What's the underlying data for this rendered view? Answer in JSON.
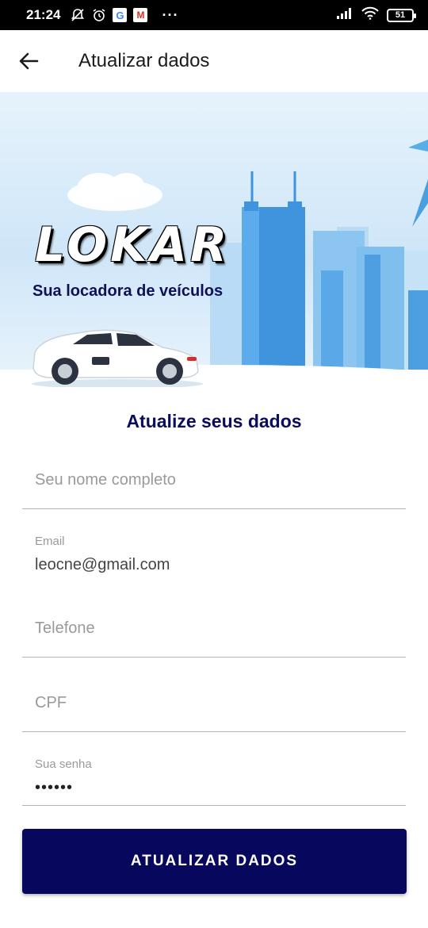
{
  "status_bar": {
    "time": "21:24",
    "google_letter": "G",
    "gmail_letter": "M",
    "more": "···",
    "battery": "51"
  },
  "appbar": {
    "title": "Atualizar dados"
  },
  "banner": {
    "logo_text": "LOKAR",
    "tagline": "Sua locadora de veículos"
  },
  "form": {
    "title": "Atualize seus dados",
    "name_placeholder": "Seu nome completo",
    "name_value": "",
    "email_label": "Email",
    "email_value": "leocne@gmail.com",
    "phone_placeholder": "Telefone",
    "phone_value": "",
    "cpf_placeholder": "CPF",
    "cpf_value": "",
    "password_label": "Sua senha",
    "password_value": "123456",
    "submit_label": "ATUALIZAR DADOS"
  },
  "colors": {
    "primary": "#07075e",
    "title": "#0c0c5c",
    "sky": "#cfe6f8",
    "building": "#4a9fe0"
  }
}
